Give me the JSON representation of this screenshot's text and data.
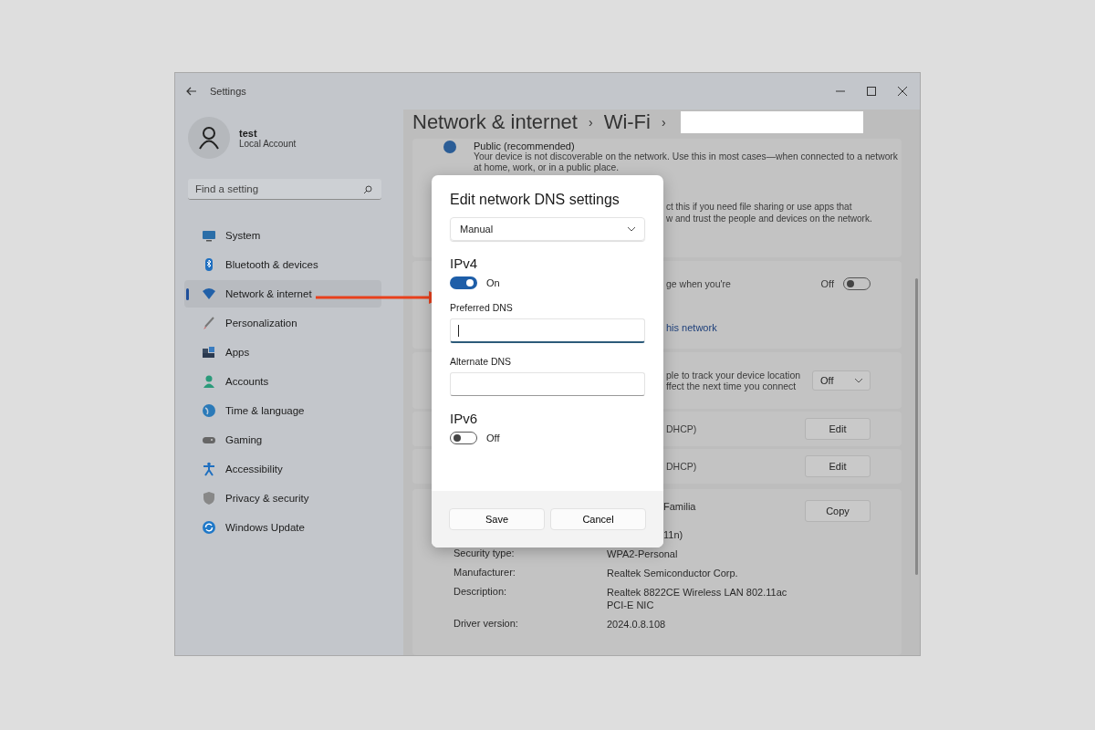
{
  "window": {
    "title": "Settings"
  },
  "account": {
    "name": "test",
    "type": "Local Account"
  },
  "search": {
    "placeholder": "Find a setting"
  },
  "sidebar": {
    "items": [
      {
        "label": "System",
        "kind": "system",
        "selected": false
      },
      {
        "label": "Bluetooth & devices",
        "kind": "bluetooth",
        "selected": false
      },
      {
        "label": "Network & internet",
        "kind": "network",
        "selected": true
      },
      {
        "label": "Personalization",
        "kind": "brush",
        "selected": false
      },
      {
        "label": "Apps",
        "kind": "apps",
        "selected": false
      },
      {
        "label": "Accounts",
        "kind": "accounts",
        "selected": false
      },
      {
        "label": "Time & language",
        "kind": "globe",
        "selected": false
      },
      {
        "label": "Gaming",
        "kind": "gaming",
        "selected": false
      },
      {
        "label": "Accessibility",
        "kind": "accessibility",
        "selected": false
      },
      {
        "label": "Privacy & security",
        "kind": "shield",
        "selected": false
      },
      {
        "label": "Windows Update",
        "kind": "update",
        "selected": false
      }
    ]
  },
  "breadcrumb": [
    "Network & internet",
    "Wi-Fi"
  ],
  "breadcrumb_separators": [
    "›",
    "›"
  ],
  "profile": {
    "option": "Public (recommended)",
    "selected": true,
    "description": "Your device is not discoverable on the network. Use this in most cases—when connected to a network at home, work, or in a public place."
  },
  "private_fragment": [
    "ct this if you need file sharing or use apps that",
    "w and trust the people and devices on the network."
  ],
  "metered": {
    "text": "ge when you're",
    "state": "Off",
    "on": false,
    "link": "his network"
  },
  "location": {
    "lines": [
      "ple to track your device location",
      "ffect the next time you connect"
    ],
    "dropdown": "Off"
  },
  "ip_rows": [
    {
      "value": "DHCP)",
      "button": "Edit"
    },
    {
      "value": "DHCP)",
      "button": "Edit"
    }
  ],
  "properties": [
    {
      "value": "Familia",
      "button": "Copy"
    },
    {
      "value": "11n)"
    },
    {
      "label": "Security type:",
      "value": "WPA2-Personal"
    },
    {
      "label": "Manufacturer:",
      "value": "Realtek Semiconductor Corp."
    },
    {
      "label": "Description:",
      "value": "Realtek 8822CE Wireless LAN 802.11ac PCI-E NIC"
    },
    {
      "label": "Driver version:",
      "value": "2024.0.8.108"
    }
  ],
  "dialog": {
    "title": "Edit network DNS settings",
    "mode": "Manual",
    "sections": [
      {
        "heading": "IPv4",
        "on": true,
        "state": "On",
        "fields": [
          {
            "label": "Preferred DNS",
            "focused": true
          },
          {
            "label": "Alternate DNS",
            "focused": false
          }
        ]
      },
      {
        "heading": "IPv6",
        "on": false,
        "state": "Off"
      }
    ],
    "buttons": [
      "Save",
      "Cancel"
    ]
  }
}
